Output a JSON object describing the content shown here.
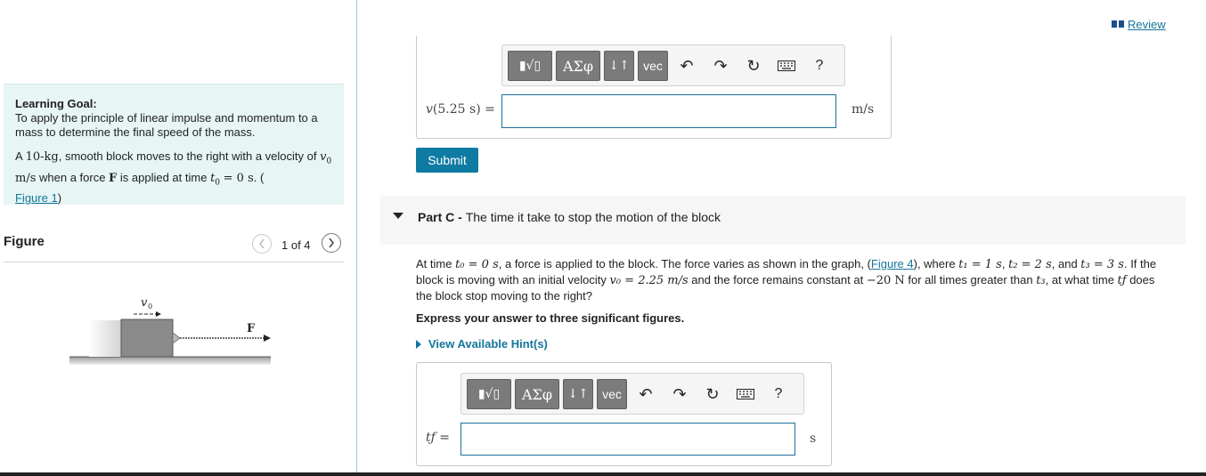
{
  "header": {
    "review_label": "Review"
  },
  "learning_goal": {
    "heading": "Learning Goal:",
    "text": "To apply the principle of linear impulse and momentum to a mass to determine the final speed of the mass.",
    "problem_pre": "A ",
    "mass": "10-kg",
    "problem_mid1": ", smooth block moves to the right with a velocity of ",
    "v0": "v",
    "v0_unit": " m/s",
    "problem_mid2": " when a force ",
    "force": "F",
    "problem_mid3": " is applied at time ",
    "time_eq": "= 0 s",
    "problem_end": ". (",
    "figure_link": "Figure 1",
    "close": ")"
  },
  "figure": {
    "title": "Figure",
    "pager": "1 of 4",
    "v0_label": "v",
    "force_label": "F"
  },
  "part_b": {
    "answer_label": "v(5.25 s) =",
    "unit": "m/s",
    "answer_value": "",
    "submit_label": "Submit"
  },
  "toolbar": {
    "templates": "▮√▯",
    "greek": "ΑΣφ",
    "arrows": "↓↑",
    "vec": "vec",
    "help": "?"
  },
  "part_c": {
    "title_bold": "Part C - ",
    "title": "The time it take to stop the motion of the block",
    "q_line1_a": "At time ",
    "q_line1_b": ", a force is applied to the block. The force varies as shown in the graph, (",
    "q_figure_link": "Figure 4",
    "q_line1_c": "), where ",
    "q_line1_d": ", and ",
    "q_line1_e": ". If the",
    "q_line2_a": "block is moving with an initial velocity ",
    "q_line2_b": " and the force remains constant at ",
    "q_line2_c": " for all times greater than ",
    "q_line2_d": ", at what time ",
    "q_line2_e": " does",
    "q_line3": "the block stop moving to the right?",
    "t0_eq": "t₀ = 0 s",
    "t1_eq": "t₁ = 1 s",
    "t2_eq": "t₂ = 2 s",
    "t3_eq": "t₃ = 3 s",
    "v0_eq": "v₀ = 2.25 m/s",
    "force_val": "−20 N",
    "t3": "t₃",
    "tf": "tƒ",
    "instruction": "Express your answer to three significant figures.",
    "hints": "View Available Hint(s)",
    "answer_label": "tƒ =",
    "unit": "s",
    "answer_value": ""
  }
}
